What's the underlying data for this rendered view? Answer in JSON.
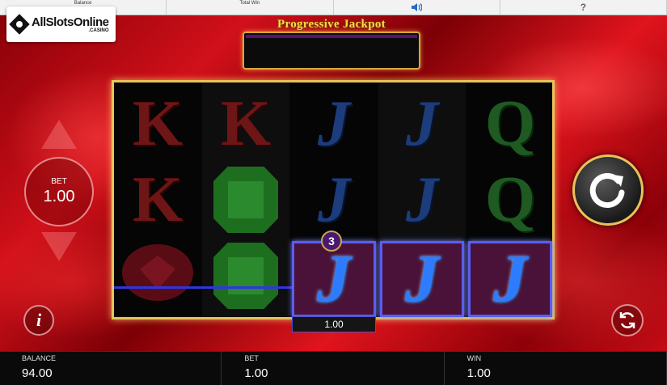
{
  "topbar": {
    "balance_label": "Balance",
    "total_win_label": "Total Win",
    "help_label": "?"
  },
  "logo": {
    "main": "AllSlotsOnline",
    "sub": ".CASINO"
  },
  "jackpot": {
    "title": "Progressive Jackpot",
    "value": ""
  },
  "reels": {
    "columns": [
      [
        "K",
        "K",
        "red-gem"
      ],
      [
        "K",
        "green-gem",
        "green-gem"
      ],
      [
        "J",
        "J",
        "J"
      ],
      [
        "J",
        "J",
        "J"
      ],
      [
        "Q",
        "Q",
        "J"
      ]
    ],
    "winning_symbol": "J",
    "win_count_badge": "3",
    "win_amount": "1.00"
  },
  "controls": {
    "bet_label": "BET",
    "bet_value": "1.00",
    "info_label": "i"
  },
  "bottom": {
    "balance_label": "BALANCE",
    "balance_value": "94.00",
    "bet_label": "BET",
    "bet_value": "1.00",
    "win_label": "WIN",
    "win_value": "1.00"
  },
  "colors": {
    "gold": "#e8c35a",
    "win_frame": "#5a5ef0",
    "background_red": "#d1101a"
  },
  "icons": [
    "speaker-icon",
    "spin-arrow-icon",
    "autoplay-icon",
    "info-icon",
    "bet-up-arrow-icon",
    "bet-down-arrow-icon"
  ]
}
